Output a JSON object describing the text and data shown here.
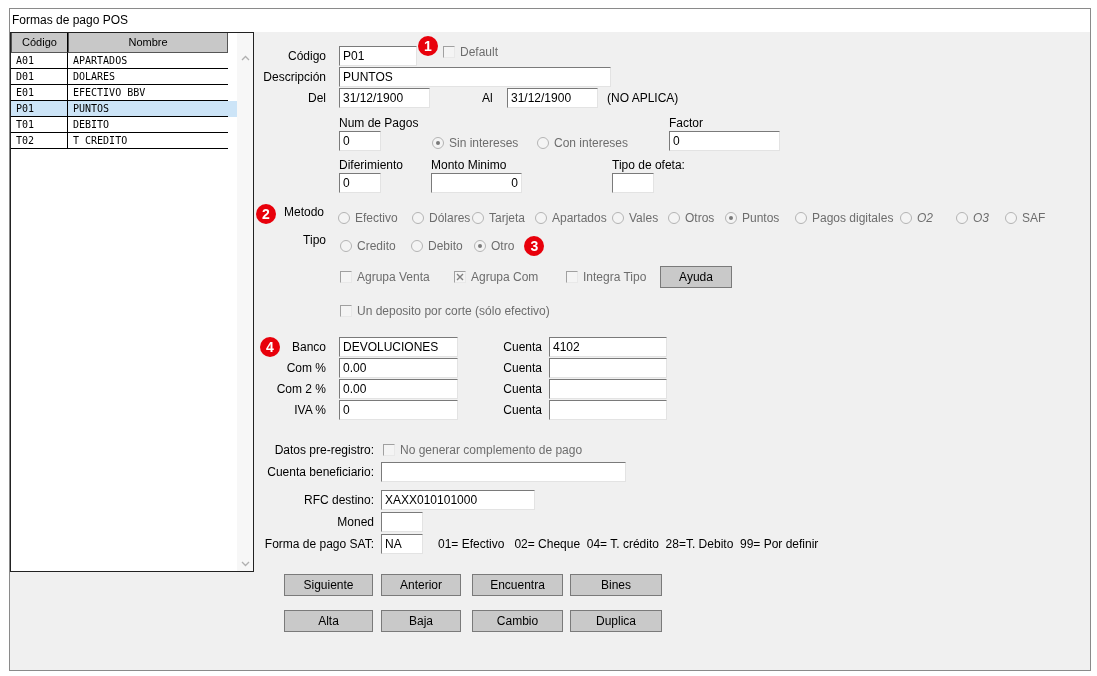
{
  "window": {
    "title": "Formas de pago POS"
  },
  "list": {
    "columns": [
      "Código",
      "Nombre"
    ],
    "rows": [
      {
        "code": "A01",
        "name": "APARTADOS",
        "selected": false
      },
      {
        "code": "D01",
        "name": "DOLARES",
        "selected": false
      },
      {
        "code": "E01",
        "name": "EFECTIVO BBV",
        "selected": false
      },
      {
        "code": "P01",
        "name": "PUNTOS",
        "selected": true
      },
      {
        "code": "T01",
        "name": "DEBITO",
        "selected": false
      },
      {
        "code": "T02",
        "name": "T CREDITO",
        "selected": false
      }
    ]
  },
  "form": {
    "codigo": {
      "label": "Código",
      "value": "P01",
      "callout": "1"
    },
    "default": {
      "label": "Default",
      "checked": false,
      "disabled": true
    },
    "descripcion": {
      "label": "Descripción",
      "value": "PUNTOS"
    },
    "del": {
      "label": "Del",
      "value": "31/12/1900"
    },
    "al": {
      "label": "Al",
      "value": "31/12/1900"
    },
    "vigencia_note": "(NO APLICA)",
    "num_pagos": {
      "label": "Num de Pagos",
      "value": "0"
    },
    "intereses": [
      {
        "label": "Sin intereses",
        "selected": true,
        "disabled": true
      },
      {
        "label": "Con intereses",
        "selected": false,
        "disabled": true
      }
    ],
    "factor": {
      "label": "Factor",
      "value": "0"
    },
    "diferimiento": {
      "label": "Diferimiento",
      "value": "0"
    },
    "monto_minimo": {
      "label": "Monto Minimo",
      "value": "0"
    },
    "tipo_oferta": {
      "label": "Tipo de ofeta:"
    },
    "metodo": {
      "label": "Metodo",
      "callout": "2",
      "options": [
        {
          "label": "Efectivo",
          "selected": false,
          "disabled": true,
          "italic": false
        },
        {
          "label": "Dólares",
          "selected": false,
          "disabled": true,
          "italic": false
        },
        {
          "label": "Tarjeta",
          "selected": false,
          "disabled": true,
          "italic": false
        },
        {
          "label": "Apartados",
          "selected": false,
          "disabled": true,
          "italic": false
        },
        {
          "label": "Vales",
          "selected": false,
          "disabled": true,
          "italic": false
        },
        {
          "label": "Otros",
          "selected": false,
          "disabled": true,
          "italic": false
        },
        {
          "label": "Puntos",
          "selected": true,
          "disabled": true,
          "italic": false
        },
        {
          "label": "Pagos digitales",
          "selected": false,
          "disabled": true,
          "italic": false
        },
        {
          "label": "O2",
          "selected": false,
          "disabled": true,
          "italic": true
        },
        {
          "label": "O3",
          "selected": false,
          "disabled": true,
          "italic": true
        },
        {
          "label": "SAF",
          "selected": false,
          "disabled": true,
          "italic": false
        }
      ]
    },
    "tipo": {
      "label": "Tipo",
      "callout": "3",
      "options": [
        {
          "label": "Credito",
          "selected": false,
          "disabled": true,
          "italic": false
        },
        {
          "label": "Debito",
          "selected": false,
          "disabled": true,
          "italic": false
        },
        {
          "label": "Otro",
          "selected": true,
          "disabled": true,
          "italic": false
        }
      ]
    },
    "flags": [
      {
        "label": "Agrupa Venta",
        "checked": false,
        "disabled": true
      },
      {
        "label": "Agrupa Com",
        "checked": true,
        "disabled": true
      },
      {
        "label": "Integra Tipo",
        "checked": false,
        "disabled": true
      }
    ],
    "help_button": "Ayuda",
    "deposito": {
      "label": "Un deposito por corte (sólo efectivo)",
      "checked": false,
      "disabled": true
    },
    "bank_callout": "4",
    "bank_rows": [
      {
        "label": "Banco",
        "value": "DEVOLUCIONES",
        "account_label": "Cuenta",
        "account": "4102"
      },
      {
        "label": "Com %",
        "value": "0.00",
        "account_label": "Cuenta"
      },
      {
        "label": "Com 2 %",
        "value": "0.00",
        "account_label": "Cuenta"
      },
      {
        "label": "IVA %",
        "value": "0",
        "account_label": "Cuenta"
      }
    ],
    "pre_registro": {
      "label": "Datos pre-registro:",
      "option": {
        "label": "No generar complemento de pago",
        "checked": false,
        "disabled": true
      }
    },
    "cuenta_beneficiario": {
      "label": "Cuenta beneficiario:"
    },
    "rfc_destino": {
      "label": "RFC destino:",
      "value": "XAXX010101000"
    },
    "moneda": {
      "label": "Moned"
    },
    "forma_pago_sat": {
      "label": "Forma de pago SAT:",
      "value": "NA"
    },
    "sat_legend": "01= Efectivo   02= Cheque  04= T. crédito  28=T. Debito  99= Por definir"
  },
  "buttons": [
    [
      "Siguiente",
      "Anterior",
      "Encuentra",
      "Bines"
    ],
    [
      "Alta",
      "Baja",
      "Cambio",
      "Duplica"
    ]
  ]
}
